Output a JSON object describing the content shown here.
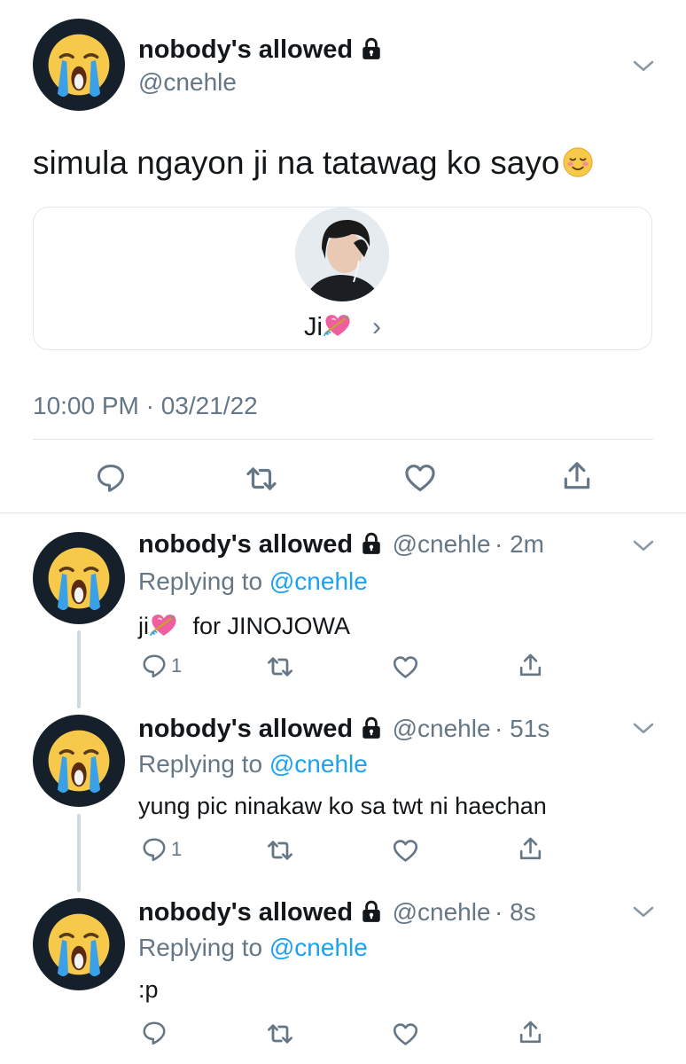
{
  "main_tweet": {
    "display_name": "nobody's allowed",
    "handle": "@cnehle",
    "text": "simula ngayon ji na tatawag ko sayo",
    "text_emoji": "smiling-face-icon",
    "card": {
      "label": "Ji",
      "label_emoji": "heart-with-arrow-icon",
      "chevron": "›"
    },
    "timestamp": "10:00 PM · 03/21/22"
  },
  "replies": [
    {
      "display_name": "nobody's allowed",
      "handle": "@cnehle",
      "time": "· 2m",
      "replying_prefix": "Replying to",
      "replying_handle": "@cnehle",
      "text_before": "ji",
      "text_emoji": "heart-with-arrow-icon",
      "text_after": " for JINOJOWA",
      "reply_count": "1"
    },
    {
      "display_name": "nobody's allowed",
      "handle": "@cnehle",
      "time": "· 51s",
      "replying_prefix": "Replying to",
      "replying_handle": "@cnehle",
      "text": "yung pic ninakaw ko sa twt ni haechan",
      "reply_count": "1"
    },
    {
      "display_name": "nobody's allowed",
      "handle": "@cnehle",
      "time": "· 8s",
      "replying_prefix": "Replying to",
      "replying_handle": "@cnehle",
      "text": ":p",
      "reply_count": ""
    }
  ],
  "colors": {
    "link": "#1da1f2",
    "secondary": "#657786",
    "avatar_bg": "#15202b",
    "divider": "#e1e8ed"
  }
}
